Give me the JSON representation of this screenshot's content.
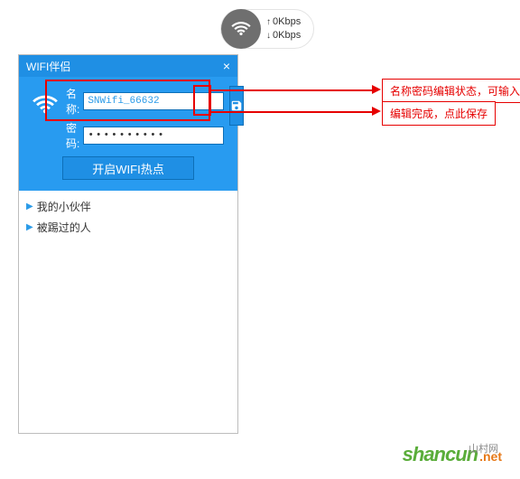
{
  "speed": {
    "up": "0Kbps",
    "down": "0Kbps"
  },
  "window": {
    "title": "WIFI伴侣",
    "name_label": "名称:",
    "name_value": "SNWifi_66632",
    "pw_label": "密码:",
    "pw_value": "••••••••••",
    "start_btn": "开启WIFI热点"
  },
  "list": {
    "item1": "我的小伙伴",
    "item2": "被踢过的人"
  },
  "callouts": {
    "c1": "名称密码编辑状态，可输入",
    "c2": "编辑完成，点此保存"
  },
  "watermark": {
    "brand": "shancun",
    "cn": "山村网",
    "net": ".net"
  }
}
